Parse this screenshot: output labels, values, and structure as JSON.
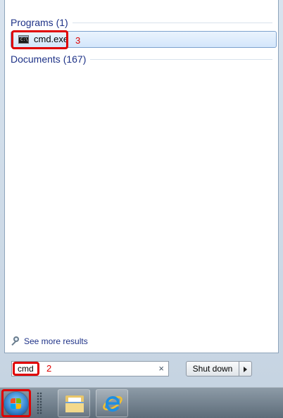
{
  "start_menu": {
    "groups": [
      {
        "title": "Programs (1)"
      },
      {
        "title": "Documents (167)"
      }
    ],
    "results": [
      {
        "label": "cmd.exe",
        "icon": "console-icon"
      }
    ],
    "see_more_label": "See more results",
    "search": {
      "value": "cmd",
      "clear_glyph": "×"
    },
    "shutdown": {
      "label": "Shut down"
    }
  },
  "annotations": {
    "step_search": "2",
    "step_result": "3"
  },
  "taskbar": {
    "pinned": [
      {
        "icon": "windows-explorer-icon"
      },
      {
        "icon": "internet-explorer-icon"
      }
    ]
  },
  "colors": {
    "annotation": "#e00000",
    "group_title": "#1e3287",
    "selection_border": "#7da2ce"
  }
}
